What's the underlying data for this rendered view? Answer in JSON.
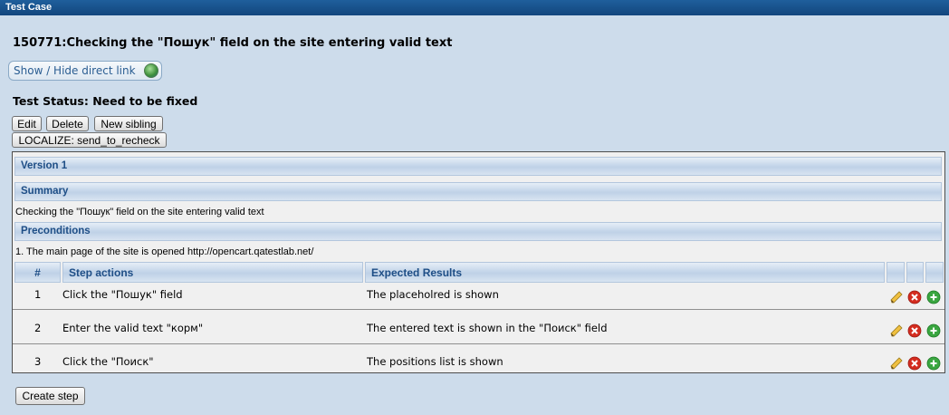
{
  "window": {
    "title": "Test Case"
  },
  "test_case": {
    "title": "150771:Checking the \"Пошук\" field on the site entering valid text",
    "direct_link_label": "Show / Hide direct link",
    "status": "Test Status: Need to be fixed"
  },
  "toolbar": {
    "edit_label": "Edit",
    "delete_label": "Delete",
    "new_sibling_label": "New sibling",
    "localize_label": "LOCALIZE: send_to_recheck"
  },
  "version": {
    "label": "Version 1"
  },
  "summary": {
    "heading": "Summary",
    "text": "Checking the \"Пошук\" field on the site entering valid text"
  },
  "preconditions": {
    "heading": "Preconditions",
    "text": "1. The main page of the site is opened http://opencart.qatestlab.net/"
  },
  "steps_table": {
    "headers": {
      "num": "#",
      "actions": "Step actions",
      "expected": "Expected Results"
    },
    "rows": [
      {
        "num": "1",
        "action": "Click the \"Пошук\" field",
        "expected": "The placeholred is shown"
      },
      {
        "num": "2",
        "action": "Enter the valid text \"корм\"",
        "expected": "The entered text is shown in the \"Поиск\" field"
      },
      {
        "num": "3",
        "action": "Click the \"Поиск\"",
        "expected": "The positions list is shown"
      }
    ],
    "row_icons": [
      "pencil-icon",
      "delete-icon",
      "add-icon"
    ]
  },
  "create_step_label": "Create step",
  "colors": {
    "titlebar": "#12467d",
    "page_bg": "#cddceb",
    "section_text": "#1e4e86",
    "delete_red": "#d42c1f",
    "add_green": "#3aa640"
  }
}
